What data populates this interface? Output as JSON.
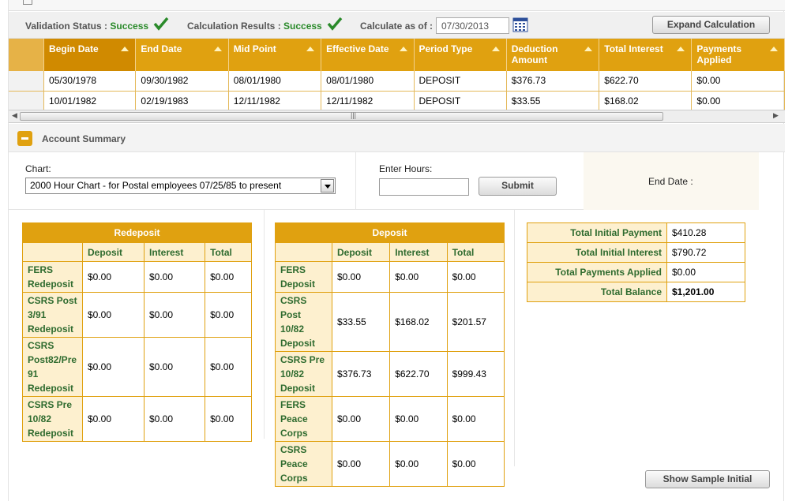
{
  "status": {
    "validation_label": "Validation Status :",
    "validation_value": "Success",
    "calc_label": "Calculation Results :",
    "calc_value": "Success",
    "as_of_label": "Calculate as of :",
    "as_of_value": "07/30/2013",
    "expand_button": "Expand Calculation"
  },
  "grid": {
    "columns": [
      "Begin Date",
      "End Date",
      "Mid Point",
      "Effective Date",
      "Period Type",
      "Deduction Amount",
      "Total Interest",
      "Payments Applied"
    ],
    "rows": [
      [
        "05/30/1978",
        "09/30/1982",
        "08/01/1980",
        "08/01/1980",
        "DEPOSIT",
        "$376.73",
        "$622.70",
        "$0.00"
      ],
      [
        "10/01/1982",
        "02/19/1983",
        "12/11/1982",
        "12/11/1982",
        "DEPOSIT",
        "$33.55",
        "$168.02",
        "$0.00"
      ]
    ]
  },
  "summary": {
    "title": "Account Summary",
    "chart_label": "Chart:",
    "chart_value": "2000 Hour Chart - for Postal employees 07/25/85 to present",
    "hours_label": "Enter Hours:",
    "hours_value": "",
    "submit_button": "Submit",
    "end_date_label": "End Date :"
  },
  "redeposit": {
    "caption": "Redeposit",
    "headers": [
      "Deposit",
      "Interest",
      "Total"
    ],
    "rows": [
      {
        "label": "FERS Redeposit",
        "values": [
          "$0.00",
          "$0.00",
          "$0.00"
        ]
      },
      {
        "label": "CSRS Post 3/91 Redeposit",
        "values": [
          "$0.00",
          "$0.00",
          "$0.00"
        ]
      },
      {
        "label": "CSRS Post82/Pre 91 Redeposit",
        "values": [
          "$0.00",
          "$0.00",
          "$0.00"
        ]
      },
      {
        "label": "CSRS Pre 10/82 Redeposit",
        "values": [
          "$0.00",
          "$0.00",
          "$0.00"
        ]
      }
    ]
  },
  "deposit": {
    "caption": "Deposit",
    "headers": [
      "Deposit",
      "Interest",
      "Total"
    ],
    "rows": [
      {
        "label": "FERS Deposit",
        "values": [
          "$0.00",
          "$0.00",
          "$0.00"
        ]
      },
      {
        "label": "CSRS Post 10/82 Deposit",
        "values": [
          "$33.55",
          "$168.02",
          "$201.57"
        ]
      },
      {
        "label": "CSRS Pre 10/82 Deposit",
        "values": [
          "$376.73",
          "$622.70",
          "$999.43"
        ]
      },
      {
        "label": "FERS Peace Corps",
        "values": [
          "$0.00",
          "$0.00",
          "$0.00"
        ]
      },
      {
        "label": "CSRS Peace Corps",
        "values": [
          "$0.00",
          "$0.00",
          "$0.00"
        ]
      }
    ]
  },
  "totals": [
    {
      "label": "Total Initial Payment",
      "value": "$410.28"
    },
    {
      "label": "Total Initial Interest",
      "value": "$790.72"
    },
    {
      "label": "Total Payments Applied",
      "value": "$0.00"
    },
    {
      "label": "Total Balance",
      "value": "$1,201.00"
    }
  ],
  "show_sample_button": "Show Sample Initial",
  "colors": {
    "accent": "#e0a110",
    "success": "#2a8a2a",
    "label_green": "#2f6b2f"
  }
}
